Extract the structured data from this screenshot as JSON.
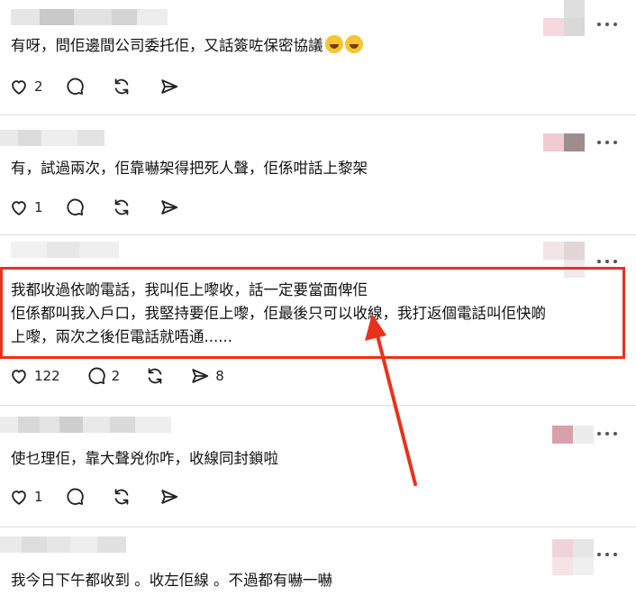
{
  "posts": [
    {
      "text": "有呀，問佢邊間公司委托佢，又話簽咗保密協議",
      "emojis": [
        "grinning-sweat-emoji",
        "grinning-sweat-emoji"
      ],
      "likes": "2",
      "comments": "",
      "reposts": "",
      "shares": ""
    },
    {
      "text": "有，試過兩次，佢靠嚇架得把死人聲，佢係咁話上黎架",
      "likes": "1",
      "comments": "",
      "reposts": "",
      "shares": ""
    },
    {
      "lines": [
        "我都收過依啲電話，我叫佢上嚟收，話一定要當面俾佢",
        "佢係都叫我入戶口，我堅持要佢上嚟，佢最後只可以收線，我打返個電話叫佢快啲",
        "上嚟，兩次之後佢電話就唔通......"
      ],
      "likes": "122",
      "comments": "2",
      "reposts": "",
      "shares": "8"
    },
    {
      "text": "使乜理佢，靠大聲兇你咋，收線同封鎖啦",
      "likes": "1",
      "comments": "",
      "reposts": "",
      "shares": ""
    },
    {
      "text": "我今日下午都收到 。收左佢線 。不過都有嚇一嚇"
    }
  ],
  "icons": {
    "like": "heart-icon",
    "comment": "comment-icon",
    "repost": "repost-icon",
    "share": "share-icon",
    "more": "more-icon"
  },
  "colors": {
    "highlight": "#e8321c",
    "divider": "#dcdcdc",
    "icon": "#222222"
  }
}
